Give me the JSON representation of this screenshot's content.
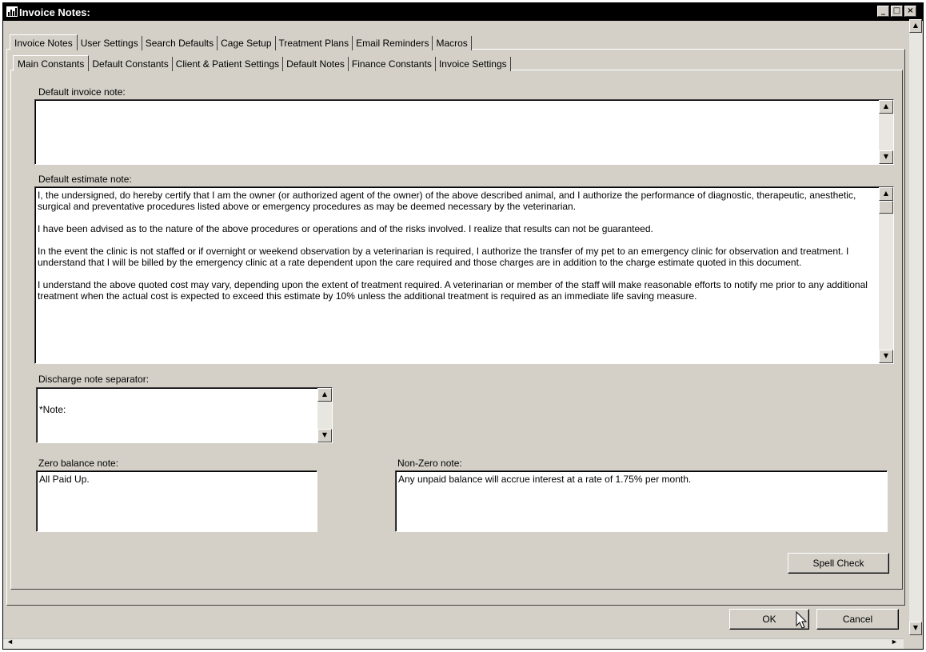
{
  "window": {
    "title": "Invoice Notes:",
    "controls": [
      "_",
      "□",
      "×"
    ]
  },
  "tabs_top": [
    {
      "label": "Invoice Notes",
      "active": true
    },
    {
      "label": "User Settings",
      "active": false
    },
    {
      "label": "Search Defaults",
      "active": false
    },
    {
      "label": "Cage Setup",
      "active": false
    },
    {
      "label": "Treatment Plans",
      "active": false
    },
    {
      "label": "Email Reminders",
      "active": false
    },
    {
      "label": "Macros",
      "active": false
    }
  ],
  "tabs_sub": [
    {
      "label": "Main Constants",
      "active": true
    },
    {
      "label": "Default Constants",
      "active": false
    },
    {
      "label": "Client & Patient Settings",
      "active": false
    },
    {
      "label": "Default Notes",
      "active": false
    },
    {
      "label": "Finance Constants",
      "active": false
    },
    {
      "label": "Invoice Settings",
      "active": false
    }
  ],
  "fields": {
    "invoice_note_label": "Default invoice note:",
    "invoice_note_value": "",
    "estimate_note_label": "Default estimate note:",
    "estimate_note_paragraphs": [
      "I, the undersigned, do hereby certify that I am the owner (or authorized agent of the owner) of the above described animal, and I authorize the performance of diagnostic, therapeutic, anesthetic, surgical and preventative procedures listed above or emergency procedures as may be deemed necessary by the veterinarian.",
      "I have been advised as to the nature of the above procedures or operations and of the risks involved.  I realize that results can not be guaranteed.",
      "In the event the clinic is not staffed or if overnight or weekend observation by a veterinarian is required, I authorize the transfer of my pet to an emergency clinic for observation and treatment.  I understand that I will be billed by the emergency clinic at a rate dependent upon the care required and those charges are in addition to the charge estimate quoted in this document.",
      "I understand the above quoted cost may vary, depending upon the extent of treatment required.  A veterinarian or member of the staff will make reasonable efforts to notify me prior to any additional treatment when the actual cost is expected to exceed this estimate by 10% unless the additional treatment is required as an immediate life saving measure."
    ],
    "discharge_label": "Discharge note separator:",
    "discharge_value": "*Note:",
    "zero_balance_label": "Zero balance note:",
    "zero_balance_value": "All Paid Up.",
    "nonzero_label": "Non-Zero note:",
    "nonzero_value": "Any unpaid balance will accrue interest at a rate of 1.75% per month."
  },
  "buttons": {
    "spell_check": "Spell Check",
    "ok": "OK",
    "cancel": "Cancel"
  },
  "icons": {
    "app": "app-icon",
    "scroll_up": "▲",
    "scroll_down": "▼",
    "scroll_left": "◄",
    "scroll_right": "►"
  }
}
